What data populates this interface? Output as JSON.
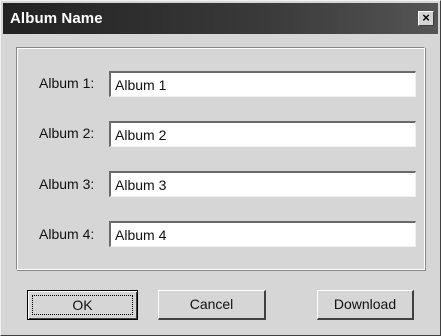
{
  "window": {
    "title": "Album Name",
    "close_glyph": "×"
  },
  "albums": [
    {
      "label": "Album 1:",
      "value": "Album 1"
    },
    {
      "label": "Album 2:",
      "value": "Album 2"
    },
    {
      "label": "Album 3:",
      "value": "Album 3"
    },
    {
      "label": "Album 4:",
      "value": "Album 4"
    }
  ],
  "buttons": {
    "ok": "OK",
    "cancel": "Cancel",
    "download": "Download"
  }
}
